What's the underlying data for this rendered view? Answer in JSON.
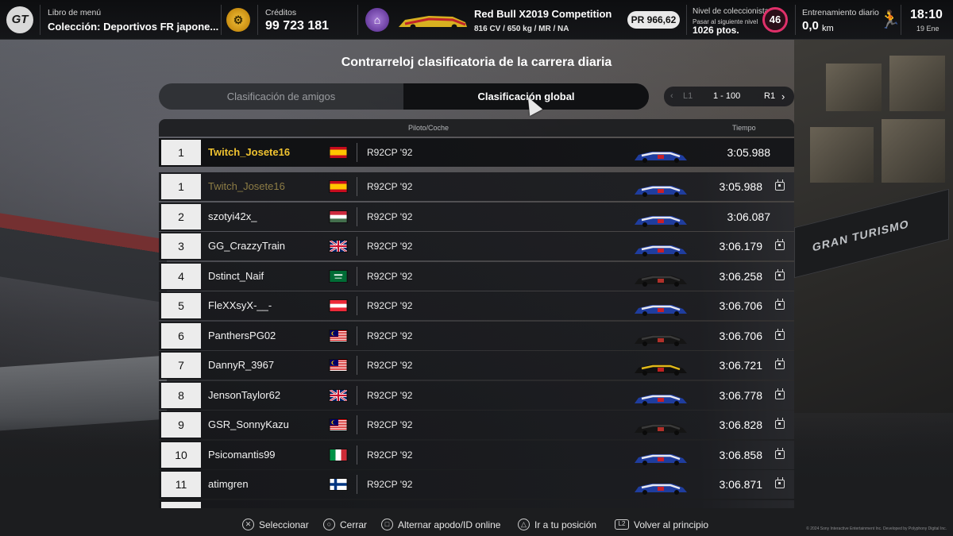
{
  "header": {
    "menu_book_label": "Libro de menú",
    "menu_book_value": "Colección: Deportivos FR japone...",
    "credits_label": "Créditos",
    "credits_value": "99 723 181",
    "car_name": "Red Bull X2019 Competition",
    "car_specs": "816 CV / 650 kg / MR / NA",
    "pr_value": "PR 966,62",
    "collector_label": "Nivel de coleccionista",
    "collector_next_label": "Pasar al siguiente nivel",
    "collector_points": "1026 ptos.",
    "collector_level": "46",
    "training_label": "Entrenamiento diario",
    "training_value": "0,0",
    "training_unit": "km",
    "clock_time": "18:10",
    "clock_date": "19 Ene"
  },
  "page_title": "Contrarreloj clasificatoria de la carrera diaria",
  "tabs": {
    "friends": "Clasificación de amigos",
    "global": "Clasificación global",
    "active": "global"
  },
  "pager": {
    "prev_label": "L1",
    "range": "1 - 100",
    "next_label": "R1"
  },
  "table": {
    "col_driver": "Piloto/Coche",
    "col_time": "Tiempo",
    "pinned": {
      "rank": "1",
      "name": "Twitch_Josete16",
      "flag": "spain",
      "car": "R92CP '92",
      "time": "3:05.988",
      "livery": "blue"
    },
    "rows": [
      {
        "rank": "1",
        "name": "Twitch_Josete16",
        "flag": "spain",
        "car": "R92CP '92",
        "time": "3:05.988",
        "replay": true,
        "livery": "blue"
      },
      {
        "rank": "2",
        "name": "szotyi42x_",
        "flag": "hungary",
        "car": "R92CP '92",
        "time": "3:06.087",
        "replay": false,
        "livery": "blue"
      },
      {
        "rank": "3",
        "name": "GG_CrazzyTrain",
        "flag": "uk",
        "car": "R92CP '92",
        "time": "3:06.179",
        "replay": true,
        "livery": "blue"
      },
      {
        "rank": "4",
        "name": "Dstinct_Naif",
        "flag": "saudi",
        "car": "R92CP '92",
        "time": "3:06.258",
        "replay": true,
        "livery": "black"
      },
      {
        "rank": "5",
        "name": "FleXXsyX-__-",
        "flag": "austria",
        "car": "R92CP '92",
        "time": "3:06.706",
        "replay": true,
        "livery": "blue"
      },
      {
        "rank": "6",
        "name": "PanthersPG02",
        "flag": "malaysia",
        "car": "R92CP '92",
        "time": "3:06.706",
        "replay": true,
        "livery": "black"
      },
      {
        "rank": "7",
        "name": "DannyR_3967",
        "flag": "malaysia",
        "car": "R92CP '92",
        "time": "3:06.721",
        "replay": true,
        "livery": "yellow"
      },
      {
        "rank": "8",
        "name": "JensonTaylor62",
        "flag": "uk",
        "car": "R92CP '92",
        "time": "3:06.778",
        "replay": true,
        "livery": "blue"
      },
      {
        "rank": "9",
        "name": "GSR_SonnyKazu",
        "flag": "malaysia",
        "car": "R92CP '92",
        "time": "3:06.828",
        "replay": true,
        "livery": "black"
      },
      {
        "rank": "10",
        "name": "Psicomantis99",
        "flag": "italy",
        "car": "R92CP '92",
        "time": "3:06.858",
        "replay": true,
        "livery": "blue"
      },
      {
        "rank": "11",
        "name": "atimgren",
        "flag": "finland",
        "car": "R92CP '92",
        "time": "3:06.871",
        "replay": true,
        "livery": "blue"
      }
    ]
  },
  "footer": {
    "select": "Seleccionar",
    "close": "Cerrar",
    "toggle": "Alternar apodo/ID online",
    "goto": "Ir a tu posición",
    "back": "Volver al principio",
    "l2_glyph": "L2"
  },
  "copyright": "© 2024 Sony Interactive Entertainment Inc. Developed by Polyphony Digital Inc.",
  "background_sign": "GRAN TURISMO",
  "icons": {
    "logo": "gt-logo-icon",
    "credits": "credits-coin-icon",
    "garage": "garage-icon",
    "training": "runner-icon",
    "replay": "replay-icon"
  },
  "colors": {
    "gold_name": "#f0c330",
    "level_ring": "#e0306a",
    "credits_coin": "#f3c13a"
  }
}
